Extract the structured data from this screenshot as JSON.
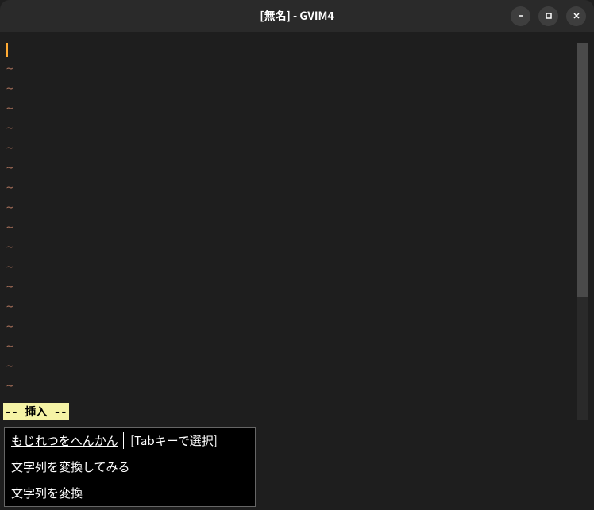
{
  "window": {
    "title": "[無名] - GVIM4"
  },
  "editor": {
    "tilde": "~",
    "tilde_count": 18
  },
  "status": {
    "mode_text": "-- 挿入 --"
  },
  "ime": {
    "reading": "もじれつをへんかん",
    "hint": "[Tabキーで選択]",
    "candidates": [
      "文字列を変換してみる",
      "文字列を変換"
    ]
  }
}
